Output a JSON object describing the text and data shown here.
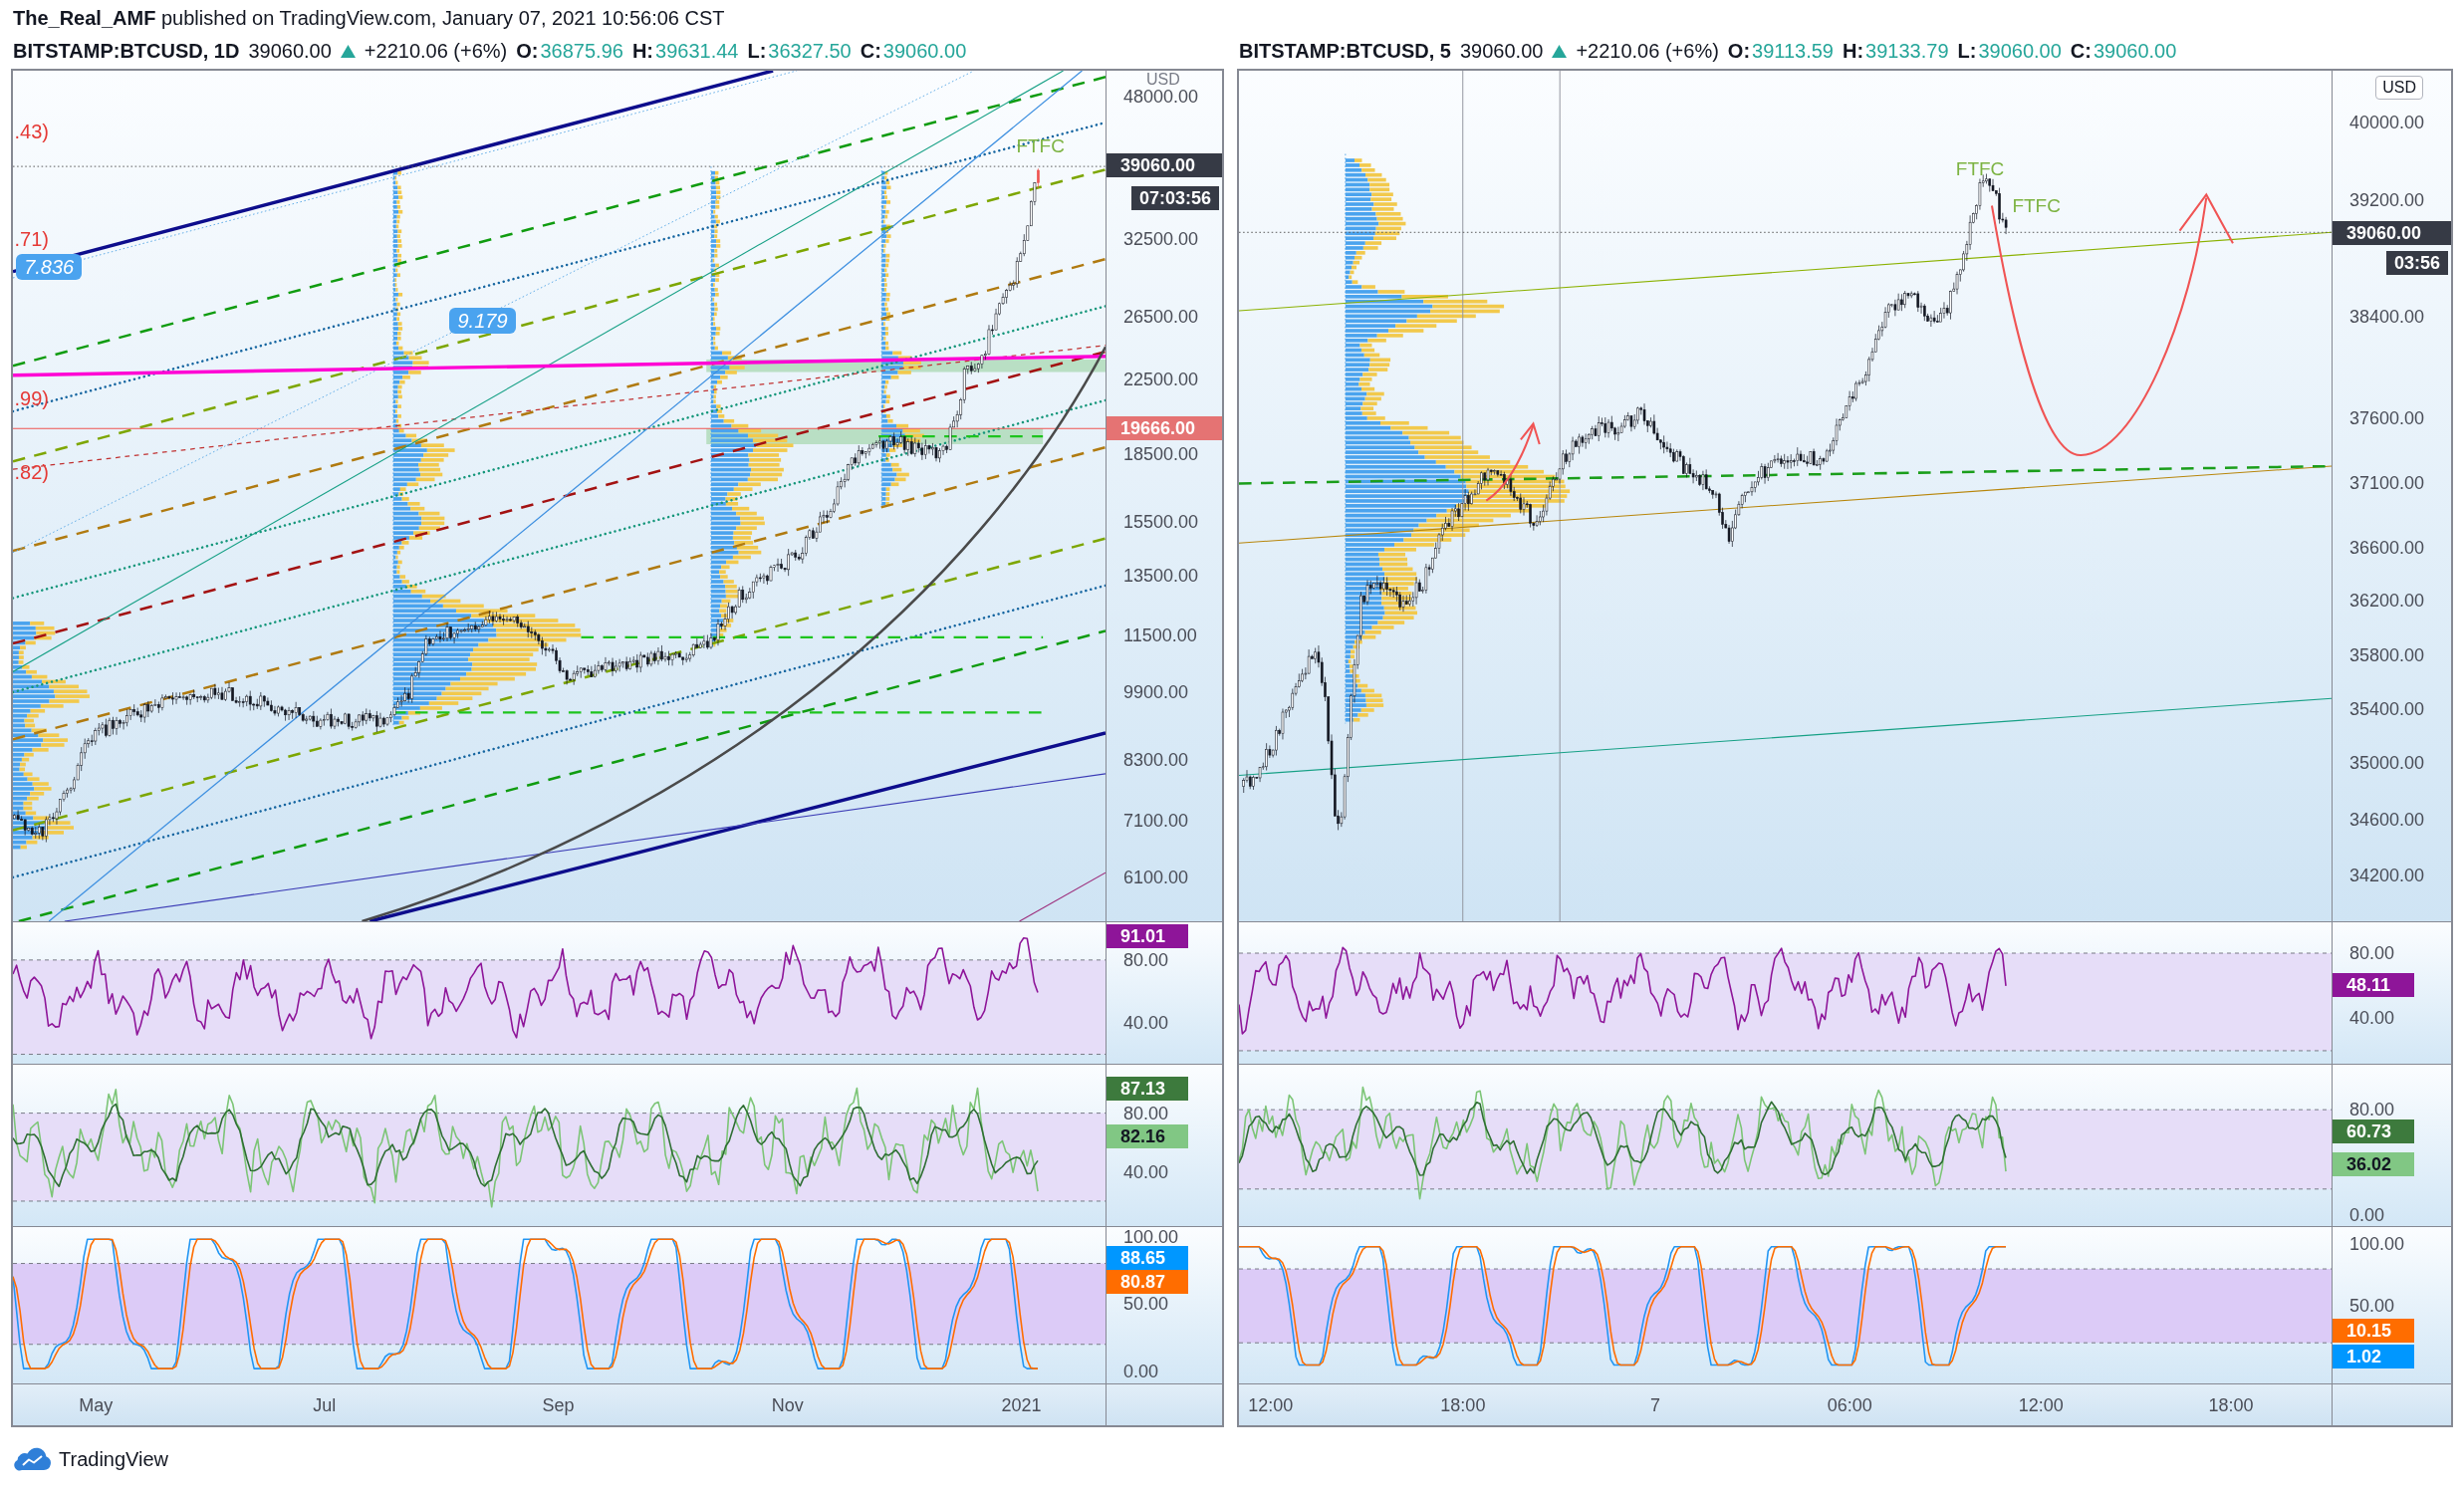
{
  "header": {
    "caption": "**The_Real_AMF** published on TradingView.com, January 07, 2021 10:56:06 CST"
  },
  "charts": [
    {
      "legend": {
        "symbol": "BITSTAMP:BTCUSD, 1D",
        "last": "39060.00",
        "rising": true,
        "change": "+2210.06 (+6%)",
        "ohlc": [
          {
            "label": "O:",
            "value": "36875.96"
          },
          {
            "label": "H:",
            "value": "39631.44"
          },
          {
            "label": "L:",
            "value": "36327.50"
          },
          {
            "label": "C:",
            "value": "39060.00"
          }
        ]
      },
      "drawing_labels": [
        {
          "kind": "note",
          "text": ".43)"
        },
        {
          "kind": "note",
          "text": ".71)"
        },
        {
          "kind": "callout",
          "text": "7.836"
        },
        {
          "kind": "note",
          "text": ".99)"
        },
        {
          "kind": "note",
          "text": ".82)"
        },
        {
          "kind": "callout",
          "text": "9.179"
        },
        {
          "kind": "signal",
          "text": "FTFC"
        }
      ],
      "price_axis": {
        "currency": {
          "kind": "plain",
          "text": "USD"
        },
        "ticks": [
          "48000.00",
          "32500.00",
          "26500.00",
          "22500.00",
          "18500.00",
          "15500.00",
          "13500.00",
          "11500.00",
          "9900.00",
          "8300.00",
          "7100.00",
          "6100.00"
        ],
        "badges": [
          {
            "kind": "price",
            "text": "39060.00",
            "color": "#363a45"
          },
          {
            "kind": "countdown",
            "text": "07:03:56",
            "color": "#363a45"
          },
          {
            "kind": "price",
            "text": "19666.00",
            "color": "#e57373"
          }
        ]
      },
      "panes": [
        {
          "ticks": [
            "80.00",
            "40.00"
          ],
          "badges": [
            {
              "text": "91.01",
              "color": "#8e1599"
            }
          ]
        },
        {
          "ticks": [
            "80.00",
            "40.00"
          ],
          "badges": [
            {
              "text": "87.13",
              "color": "#3d7a3d"
            },
            {
              "text": "82.16",
              "color": "#81c784"
            }
          ]
        },
        {
          "ticks": [
            "100.00",
            "50.00",
            "0.00"
          ],
          "badges": [
            {
              "text": "88.65",
              "color": "#0097ff"
            },
            {
              "text": "80.87",
              "color": "#ff6d00"
            }
          ]
        }
      ],
      "time_axis": [
        "May",
        "Jul",
        "Sep",
        "Nov",
        "2021"
      ]
    },
    {
      "legend": {
        "symbol": "BITSTAMP:BTCUSD, 5",
        "last": "39060.00",
        "rising": true,
        "change": "+2210.06 (+6%)",
        "ohlc": [
          {
            "label": "O:",
            "value": "39113.59"
          },
          {
            "label": "H:",
            "value": "39133.79"
          },
          {
            "label": "L:",
            "value": "39060.00"
          },
          {
            "label": "C:",
            "value": "39060.00"
          }
        ]
      },
      "drawing_labels": [
        {
          "kind": "signal",
          "text": "FTFC"
        },
        {
          "kind": "signal",
          "text": "FTFC"
        }
      ],
      "price_axis": {
        "currency": {
          "kind": "badge",
          "text": "USD"
        },
        "ticks": [
          "40000.00",
          "39200.00",
          "38400.00",
          "37600.00",
          "37100.00",
          "36600.00",
          "36200.00",
          "35800.00",
          "35400.00",
          "35000.00",
          "34600.00",
          "34200.00"
        ],
        "badges": [
          {
            "kind": "price",
            "text": "39060.00",
            "color": "#363a45"
          },
          {
            "kind": "countdown",
            "text": "03:56",
            "color": "#363a45"
          }
        ]
      },
      "panes": [
        {
          "ticks": [
            "80.00",
            "40.00"
          ],
          "badges": [
            {
              "text": "48.11",
              "color": "#8e1599"
            }
          ]
        },
        {
          "ticks": [
            "80.00",
            "0.00"
          ],
          "badges": [
            {
              "text": "60.73",
              "color": "#3d7a3d"
            },
            {
              "text": "36.02",
              "color": "#81c784"
            }
          ]
        },
        {
          "ticks": [
            "100.00",
            "50.00"
          ],
          "badges": [
            {
              "text": "10.15",
              "color": "#ff6d00"
            },
            {
              "text": "1.02",
              "color": "#0097ff"
            }
          ]
        }
      ],
      "time_axis": [
        "12:00",
        "18:00",
        "7",
        "06:00",
        "12:00",
        "18:00"
      ]
    }
  ],
  "footer": {
    "brand": "TradingView"
  }
}
